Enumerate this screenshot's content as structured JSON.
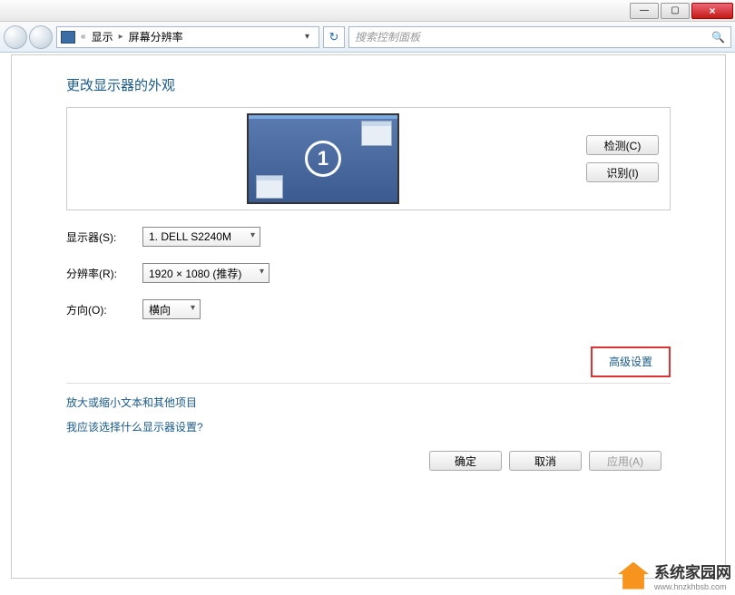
{
  "titlebar": {
    "min": "—",
    "max": "▢",
    "close": "×"
  },
  "nav": {
    "back_chev": "«",
    "crumb1": "显示",
    "arrow": "▸",
    "crumb2": "屏幕分辨率",
    "search_placeholder": "搜索控制面板"
  },
  "page": {
    "heading": "更改显示器的外观",
    "monitor_number": "1",
    "detect_btn": "检测(C)",
    "identify_btn": "识别(I)",
    "display_label": "显示器(S):",
    "display_value": "1. DELL S2240M",
    "resolution_label": "分辨率(R):",
    "resolution_value": "1920 × 1080 (推荐)",
    "orientation_label": "方向(O):",
    "orientation_value": "横向",
    "advanced": "高级设置",
    "help1": "放大或缩小文本和其他项目",
    "help2": "我应该选择什么显示器设置?",
    "ok": "确定",
    "cancel": "取消",
    "apply": "应用(A)"
  },
  "watermark": {
    "brand": "系统家园网",
    "url": "www.hnzkhbsb.com"
  }
}
